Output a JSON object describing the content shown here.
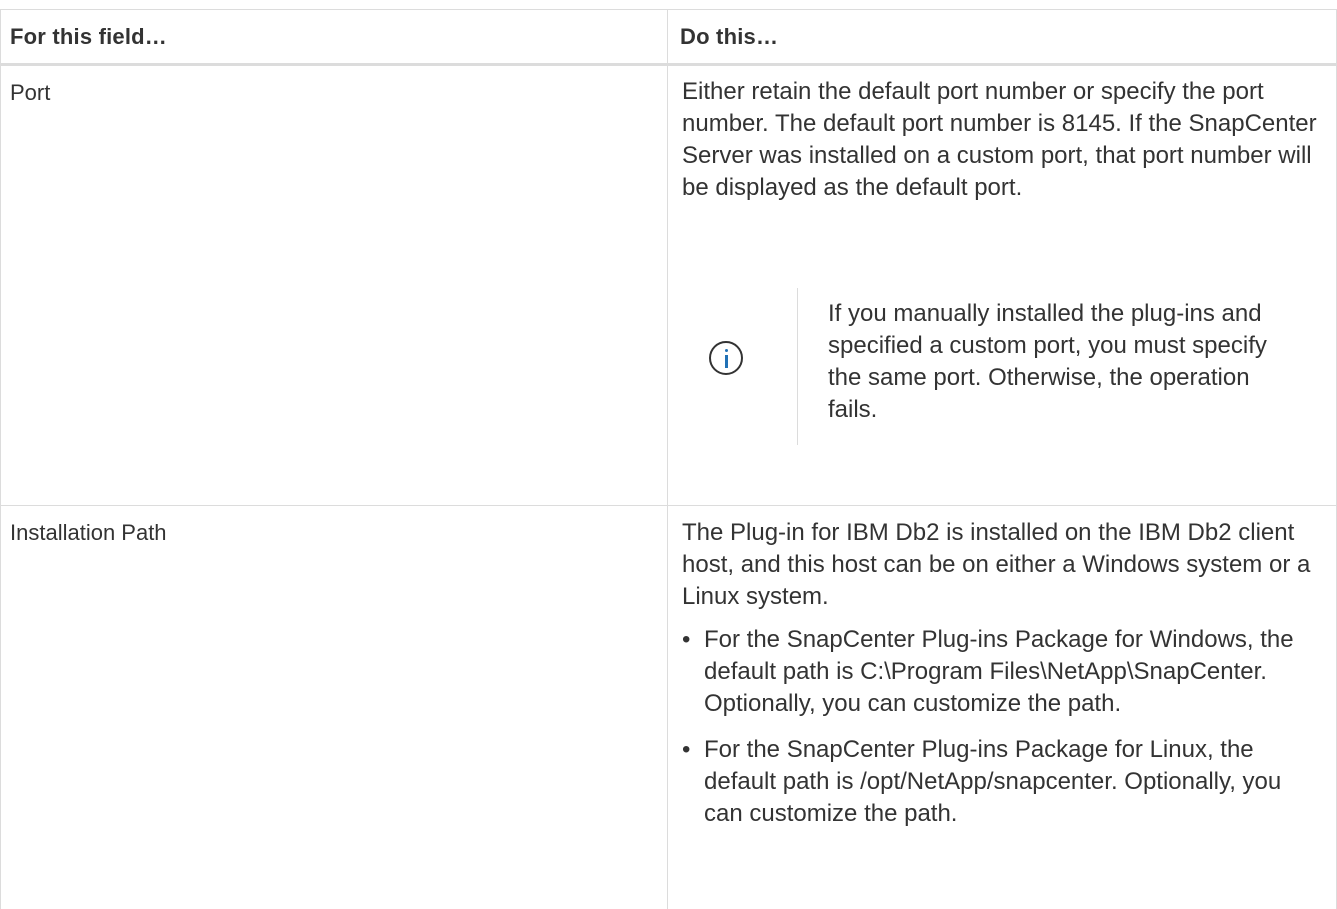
{
  "table": {
    "headers": {
      "field": "For this field…",
      "action": "Do this…"
    },
    "rows": [
      {
        "field": "Port",
        "text": "Either retain the default port number or specify the port number. The default port number is 8145. If the SnapCenter Server was installed on a custom port, that port number will be displayed as the default port.",
        "note": {
          "icon": "info-icon",
          "text": "If you manually installed the plug-ins and specified a custom port, you must specify the same port. Otherwise, the operation fails."
        }
      },
      {
        "field": "Installation Path",
        "text": "The Plug-in for IBM Db2 is installed on the IBM Db2 client host, and this host can be on either a Windows system or a Linux system.",
        "bullets": [
          "For the SnapCenter Plug-ins Package for Windows, the default path is C:\\Program Files\\NetApp\\SnapCenter. Optionally, you can customize the path.",
          "For the SnapCenter Plug-ins Package for Linux, the default path is /opt/NetApp/snapcenter. Optionally, you can customize the path."
        ]
      }
    ]
  },
  "colors": {
    "border": "#dcdcdc",
    "text": "#333333",
    "info_accent": "#2171b5"
  }
}
